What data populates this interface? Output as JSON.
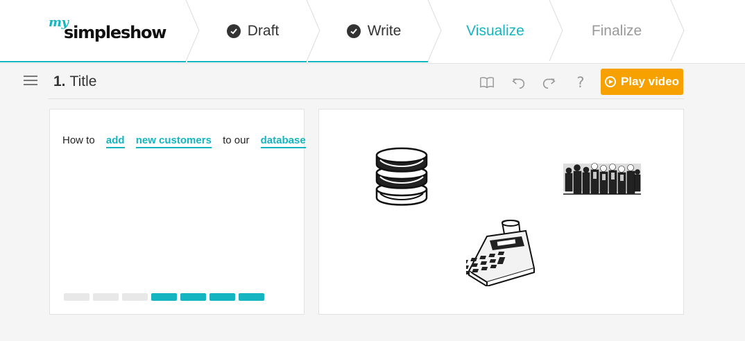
{
  "brand": {
    "my": "my",
    "name": "simpleshow"
  },
  "steps": [
    {
      "label": "Draft",
      "state": "done"
    },
    {
      "label": "Write",
      "state": "done"
    },
    {
      "label": "Visualize",
      "state": "active"
    },
    {
      "label": "Finalize",
      "state": "future"
    }
  ],
  "toolbar": {
    "scene_number": "1.",
    "scene_title": "Title",
    "help_label": "?",
    "play_label": "Play video"
  },
  "text_panel": {
    "words": [
      "How to",
      "add",
      "new customers",
      "to our",
      "database"
    ],
    "progress": {
      "filled": 4,
      "total": 7
    }
  },
  "visuals": [
    "database-icon",
    "people-crowd-image",
    "calculator-image"
  ],
  "colors": {
    "accent": "#14b5c1",
    "play": "#f7a100"
  }
}
